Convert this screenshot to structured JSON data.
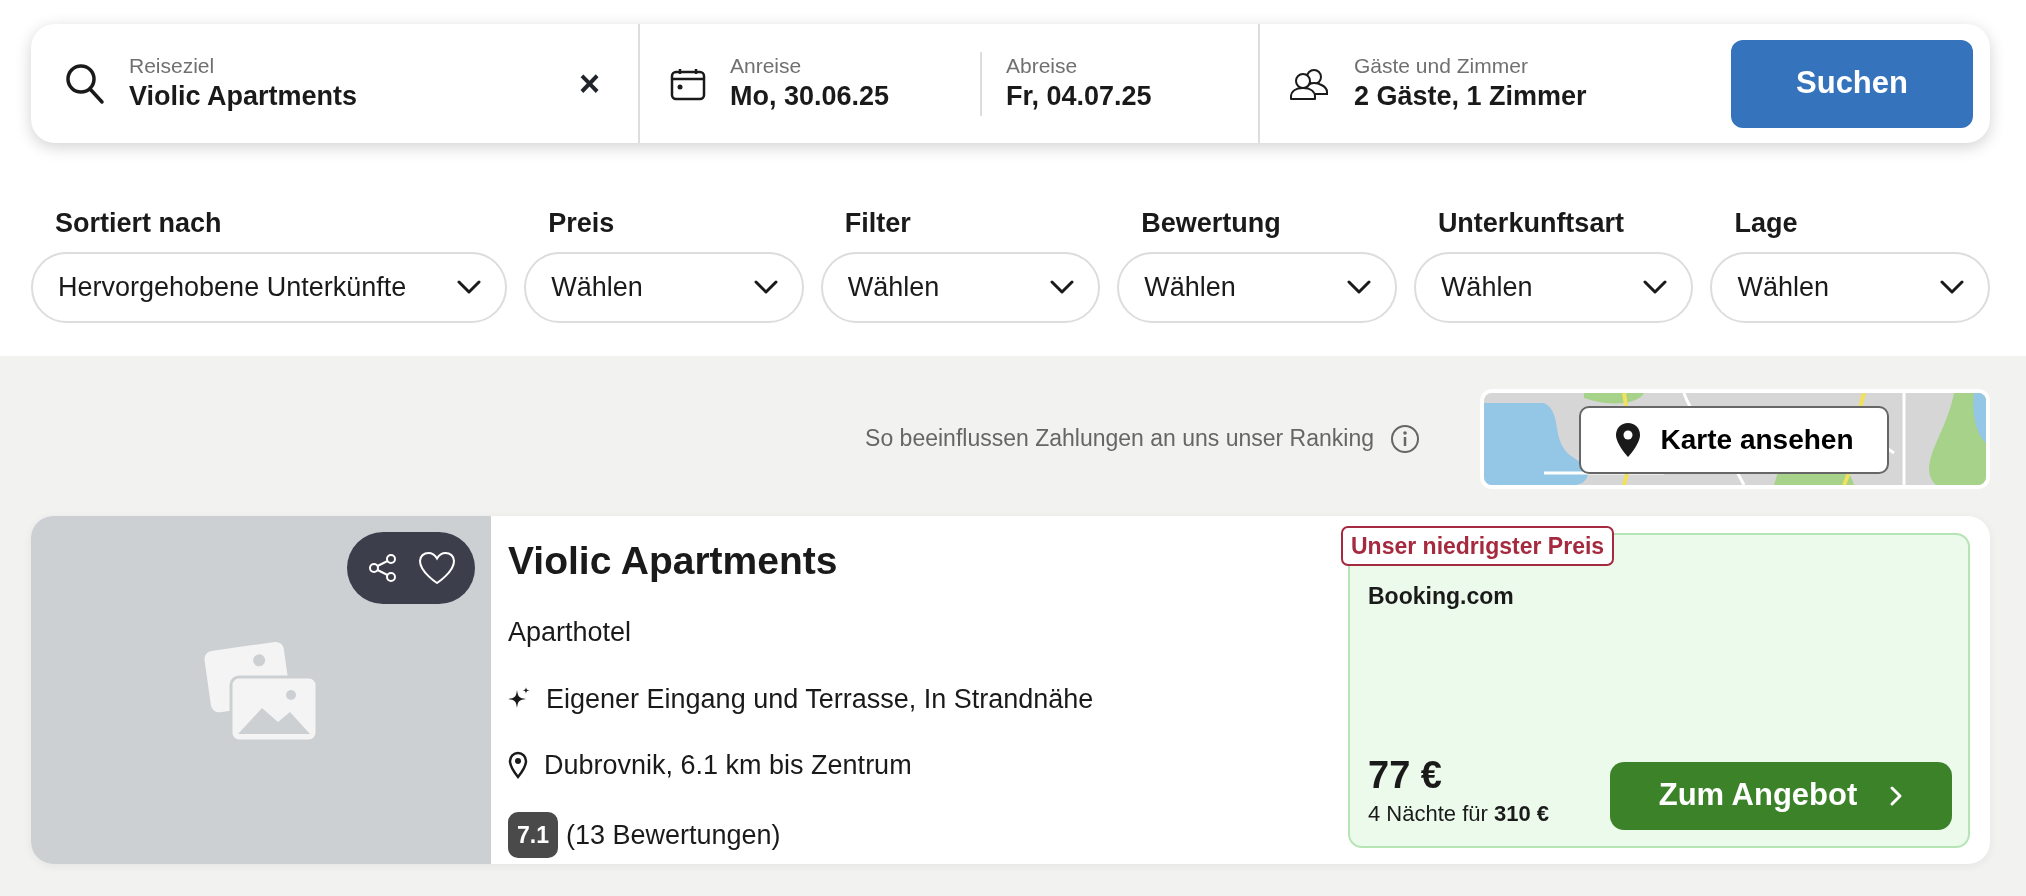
{
  "search": {
    "destination": {
      "label": "Reiseziel",
      "value": "Violic Apartments"
    },
    "clear": "×",
    "checkin": {
      "label": "Anreise",
      "value": "Mo, 30.06.25"
    },
    "checkout": {
      "label": "Abreise",
      "value": "Fr, 04.07.25"
    },
    "guests": {
      "label": "Gäste und Zimmer",
      "value": "2 Gäste, 1 Zimmer"
    },
    "button": "Suchen"
  },
  "filters": [
    {
      "label": "Sortiert nach",
      "value": "Hervorgehobene Unterkünfte"
    },
    {
      "label": "Preis",
      "value": "Wählen"
    },
    {
      "label": "Filter",
      "value": "Wählen"
    },
    {
      "label": "Bewertung",
      "value": "Wählen"
    },
    {
      "label": "Unterkunftsart",
      "value": "Wählen"
    },
    {
      "label": "Lage",
      "value": "Wählen"
    }
  ],
  "ranking_note": "So beeinflussen Zahlungen an uns unser Ranking",
  "map_button": "Karte ansehen",
  "results": [
    {
      "name": "Violic Apartments",
      "type": "Aparthotel",
      "features": "Eigener Eingang und Terrasse, In Strandnähe",
      "location": "Dubrovnik, 6.1 km bis Zentrum",
      "rating": "7.1",
      "reviews": "(13 Bewertungen)",
      "badge": "Unser niedrigster Preis",
      "provider": "Booking.com",
      "price": "77 €",
      "total": "4 Nächte für **310 €**",
      "button": "Zum Angebot"
    }
  ]
}
